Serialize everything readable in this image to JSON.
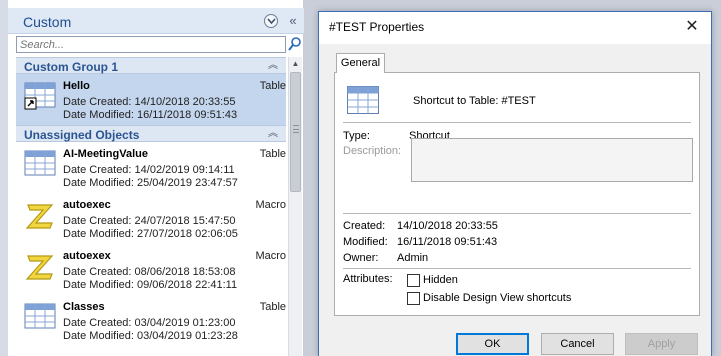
{
  "nav": {
    "title": "Custom",
    "search_placeholder": "Search...",
    "groups": [
      {
        "title": "Custom Group 1",
        "items": [
          {
            "name": "Hello",
            "type": "Table",
            "created": "Date Created: 14/10/2018 20:33:55",
            "modified": "Date Modified: 16/11/2018 09:51:43",
            "icon": "table-shortcut-icon",
            "selected": true
          }
        ]
      },
      {
        "title": "Unassigned Objects",
        "items": [
          {
            "name": "AI-MeetingValue",
            "type": "Table",
            "created": "Date Created: 14/02/2019 09:14:11",
            "modified": "Date Modified: 25/04/2019 23:47:57",
            "icon": "table-icon"
          },
          {
            "name": "autoexec",
            "type": "Macro",
            "created": "Date Created: 24/07/2018 15:47:50",
            "modified": "Date Modified: 27/07/2018 02:06:05",
            "icon": "macro-icon"
          },
          {
            "name": "autoexex",
            "type": "Macro",
            "created": "Date Created: 08/06/2018 18:53:08",
            "modified": "Date Modified: 09/06/2018 22:41:11",
            "icon": "macro-icon"
          },
          {
            "name": "Classes",
            "type": "Table",
            "created": "Date Created: 03/04/2019 01:23:00",
            "modified": "Date Modified: 03/04/2019 01:23:28",
            "icon": "table-icon"
          }
        ]
      }
    ]
  },
  "dialog": {
    "title": "#TEST Properties",
    "tab": "General",
    "shortcut_desc": "Shortcut to Table: #TEST",
    "type_label": "Type:",
    "type_value": "Shortcut",
    "description_label": "Description:",
    "created_label": "Created:",
    "created_value": "14/10/2018 20:33:55",
    "modified_label": "Modified:",
    "modified_value": "16/11/2018 09:51:43",
    "owner_label": "Owner:",
    "owner_value": "Admin",
    "attributes_label": "Attributes:",
    "hidden_label": "Hidden",
    "disable_design_label": "Disable Design View shortcuts",
    "ok": "OK",
    "cancel": "Cancel",
    "apply": "Apply"
  },
  "colors": {
    "accent": "#0078d7",
    "group_header": "#dde7f4",
    "selected": "#c4d6ee"
  }
}
